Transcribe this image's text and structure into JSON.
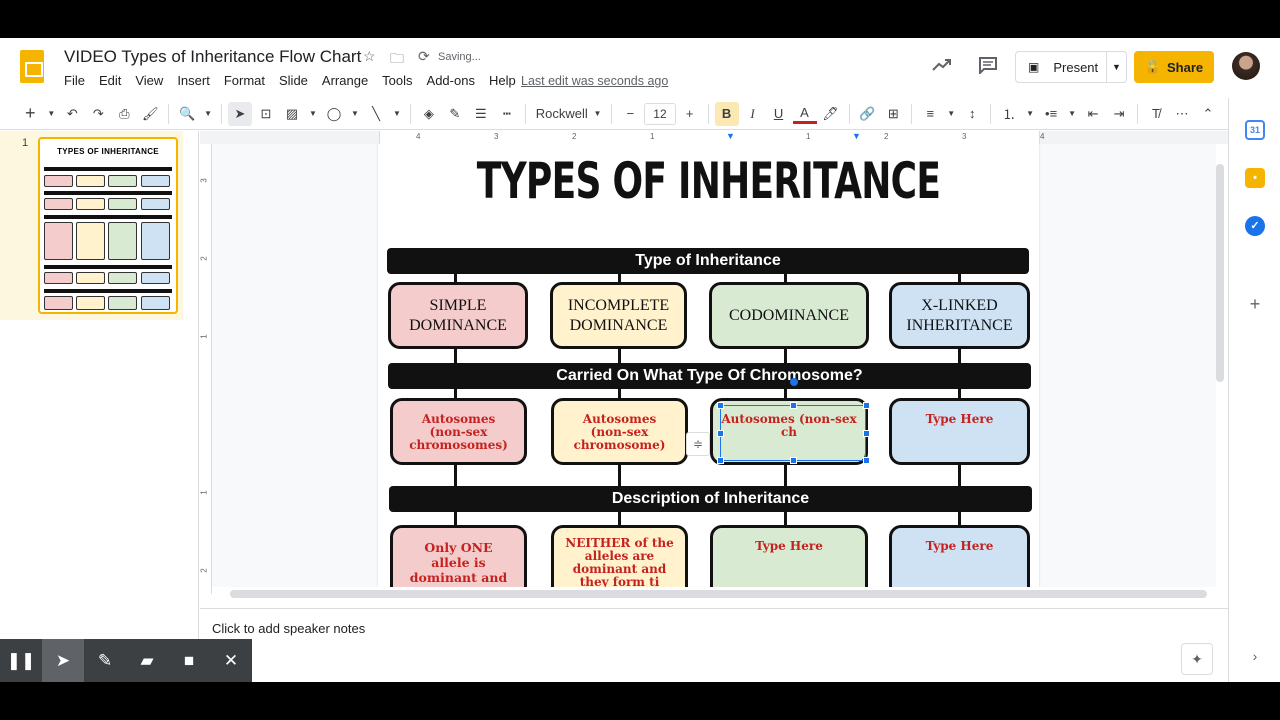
{
  "header": {
    "doc_title": "VIDEO Types of Inheritance Flow Chart",
    "saving_status": "Saving...",
    "last_edit": "Last edit was seconds ago",
    "present_label": "Present",
    "share_label": "Share",
    "brand_color": "#f4b400"
  },
  "menu": [
    "File",
    "Edit",
    "View",
    "Insert",
    "Format",
    "Slide",
    "Arrange",
    "Tools",
    "Add-ons",
    "Help"
  ],
  "toolbar": {
    "font_name": "Rockwell",
    "font_size": "12"
  },
  "filmstrip": {
    "slide_number": "1",
    "thumb_title": "TYPES OF INHERITANCE"
  },
  "rulers": {
    "horizontal": [
      "4",
      "3",
      "2",
      "1",
      "1",
      "2",
      "3",
      "4"
    ],
    "vertical": [
      "3",
      "2",
      "1",
      "1",
      "2"
    ]
  },
  "slide": {
    "title": "TYPES OF INHERITANCE",
    "header1": "Type of Inheritance",
    "header2": "Carried On What Type Of Chromosome?",
    "header3": "Description of Inheritance",
    "types": [
      {
        "line1": "SIMPLE",
        "line2": "DOMINANCE"
      },
      {
        "line1": "INCOMPLETE",
        "line2": "DOMINANCE"
      },
      {
        "line1": "CODOMINANCE",
        "line2": ""
      },
      {
        "line1": "X-LINKED",
        "line2": "INHERITANCE"
      }
    ],
    "chromosome": [
      "Autosomes (non-sex chromosomes)",
      "Autosomes (non-sex chromosome)",
      "Autosomes (non-sex ch",
      "Type Here"
    ],
    "description": [
      "Only ONE allele is dominant and over shadows",
      "NEITHER of the alleles are dominant and they form ti",
      "Type Here",
      "Type Here"
    ]
  },
  "notes": {
    "placeholder": "Click to add speaker notes"
  }
}
